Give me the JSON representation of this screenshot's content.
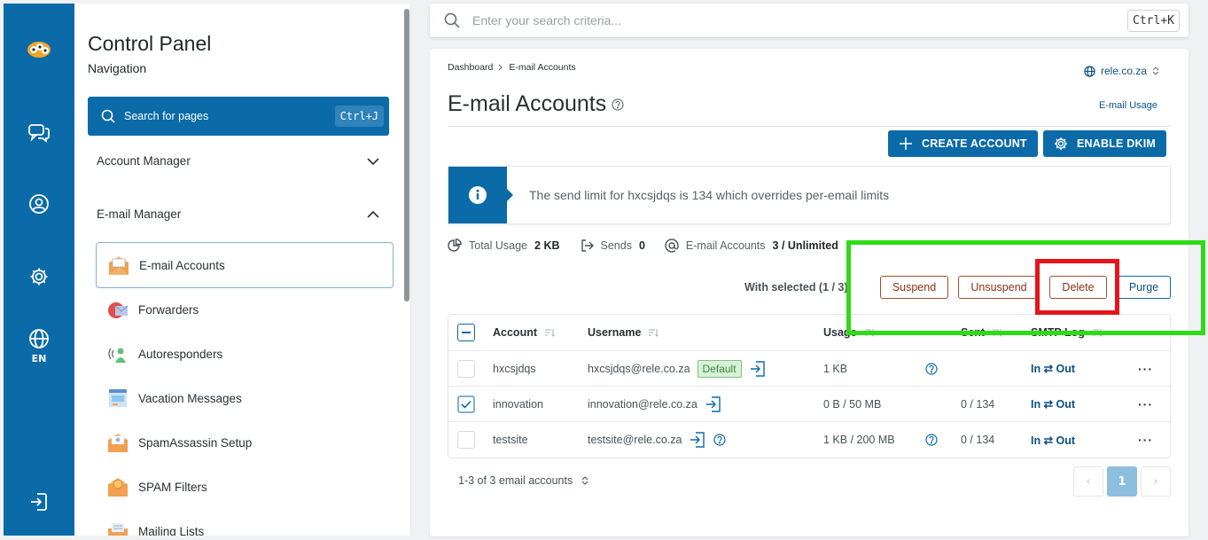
{
  "rail": {
    "items": [
      {
        "icon": "logo-icon"
      },
      {
        "icon": "chat-icon"
      },
      {
        "icon": "user-icon"
      },
      {
        "icon": "gear-icon"
      },
      {
        "icon": "globe-icon",
        "label": "EN"
      },
      {
        "icon": "logout-icon"
      }
    ]
  },
  "nav": {
    "title": "Control Panel",
    "subtitle": "Navigation",
    "search_label": "Search for pages",
    "search_shortcut": "Ctrl+J",
    "sections": [
      {
        "label": "Account Manager",
        "expanded": false
      },
      {
        "label": "E-mail Manager",
        "expanded": true
      }
    ],
    "items": [
      {
        "label": "E-mail Accounts",
        "icon": "envelope-icon",
        "active": true
      },
      {
        "label": "Forwarders",
        "icon": "forwarder-icon"
      },
      {
        "label": "Autoresponders",
        "icon": "autoresponder-icon"
      },
      {
        "label": "Vacation Messages",
        "icon": "vacation-icon"
      },
      {
        "label": "SpamAssassin Setup",
        "icon": "spamassassin-icon"
      },
      {
        "label": "SPAM Filters",
        "icon": "spam-filter-icon"
      },
      {
        "label": "Mailing Lists",
        "icon": "mailing-list-icon"
      }
    ]
  },
  "top_search": {
    "placeholder": "Enter your search criteria...",
    "shortcut": "Ctrl+K"
  },
  "main": {
    "breadcrumb": [
      "Dashboard",
      "E-mail Accounts"
    ],
    "domain": "rele.co.za",
    "title": "E-mail Accounts",
    "usage_link": "E-mail Usage",
    "create_button": "CREATE ACCOUNT",
    "dkim_button": "ENABLE DKIM",
    "info_text": "The send limit for hxcsjdqs is 134 which overrides per-email limits",
    "stats": {
      "total_usage_label": "Total Usage",
      "total_usage_value": "2 KB",
      "sends_label": "Sends",
      "sends_value": "0",
      "accounts_label": "E-mail Accounts",
      "accounts_value": "3 / Unlimited"
    },
    "with_selected": "With selected (1 / 3):",
    "bulk_actions": {
      "suspend": "Suspend",
      "unsuspend": "Unsuspend",
      "delete": "Delete",
      "purge": "Purge"
    },
    "columns": {
      "account": "Account",
      "username": "Username",
      "usage": "Usage",
      "sent": "Sent",
      "smtp_log": "SMTP Log"
    },
    "rows": [
      {
        "account": "hxcsjdqs",
        "username": "hxcsjdqs@rele.co.za",
        "default_badge": "Default",
        "usage": "1 KB",
        "sent": "",
        "smtp": "In ⇄ Out",
        "checked": false
      },
      {
        "account": "innovation",
        "username": "innovation@rele.co.za",
        "usage": "0 B / 50 MB",
        "sent": "0 / 134",
        "smtp": "In ⇄ Out",
        "checked": true
      },
      {
        "account": "testsite",
        "username": "testsite@rele.co.za",
        "usage": "1 KB / 200 MB",
        "sent": "0 / 134",
        "smtp": "In ⇄ Out",
        "checked": false
      }
    ],
    "row_menu": "···",
    "footer_count": "1-3 of 3 email accounts",
    "pager": {
      "prev": "‹",
      "current": "1",
      "next": "›"
    }
  },
  "colors": {
    "brand": "#0b6aa8",
    "highlight_green": "#2fdb18",
    "highlight_red": "#e5151b",
    "danger_border": "#a54b2a"
  }
}
